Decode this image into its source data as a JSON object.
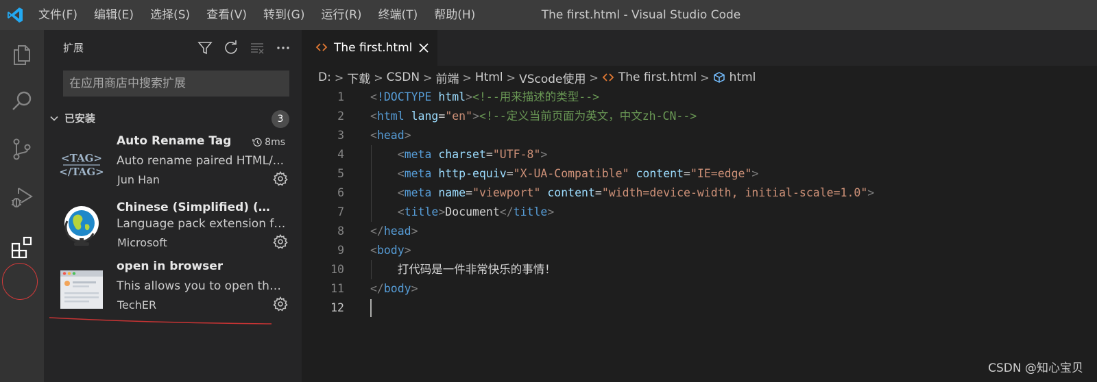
{
  "window": {
    "title": "The first.html - Visual Studio Code",
    "menu": [
      "文件(F)",
      "编辑(E)",
      "选择(S)",
      "查看(V)",
      "转到(G)",
      "运行(R)",
      "终端(T)",
      "帮助(H)"
    ]
  },
  "activity_bar": {
    "items": [
      "explorer-icon",
      "search-icon",
      "source-control-icon",
      "run-debug-icon",
      "extensions-icon"
    ],
    "active": "extensions-icon"
  },
  "sidebar": {
    "title": "扩展",
    "actions": [
      "filter-icon",
      "refresh-icon",
      "clear-icon",
      "more-icon"
    ],
    "search_placeholder": "在应用商店中搜索扩展",
    "installed_section": {
      "title": "已安装",
      "count": "3",
      "extensions": [
        {
          "name": "Auto Rename Tag",
          "time": "8ms",
          "description": "Auto rename paired HTML/...",
          "publisher": "Jun Han",
          "icon_text_top": "<TAG>",
          "icon_text_bottom": "</TAG>"
        },
        {
          "name": "Chinese (Simplified) (简...",
          "time": "",
          "description": "Language pack extension fo...",
          "publisher": "Microsoft"
        },
        {
          "name": "open in browser",
          "time": "",
          "description": "This allows you to open the ...",
          "publisher": "TechER"
        }
      ]
    }
  },
  "editor": {
    "tab": {
      "label": "The first.html"
    },
    "breadcrumb": [
      "D:",
      "下载",
      "CSDN",
      "前端",
      "Html",
      "VScode使用",
      "The first.html",
      "html"
    ],
    "active_line": "12",
    "lines": [
      {
        "n": "1",
        "tokens": [
          [
            "punct",
            "<"
          ],
          [
            "tag",
            "!DOCTYPE"
          ],
          [
            "text",
            " "
          ],
          [
            "attr",
            "html"
          ],
          [
            "punct",
            ">"
          ],
          [
            "com",
            "<!--用来描述的类型-->"
          ]
        ]
      },
      {
        "n": "2",
        "tokens": [
          [
            "punct",
            "<"
          ],
          [
            "tag",
            "html"
          ],
          [
            "text",
            " "
          ],
          [
            "attr",
            "lang"
          ],
          [
            "eq",
            "="
          ],
          [
            "str",
            "\"en\""
          ],
          [
            "punct",
            ">"
          ],
          [
            "com",
            "<!--定义当前页面为英文，中文zh-CN-->"
          ]
        ]
      },
      {
        "n": "3",
        "tokens": [
          [
            "punct",
            "<"
          ],
          [
            "tag",
            "head"
          ],
          [
            "punct",
            ">"
          ]
        ]
      },
      {
        "n": "4",
        "tokens": [
          [
            "text",
            "    "
          ],
          [
            "punct",
            "<"
          ],
          [
            "tag",
            "meta"
          ],
          [
            "text",
            " "
          ],
          [
            "attr",
            "charset"
          ],
          [
            "eq",
            "="
          ],
          [
            "str",
            "\"UTF-8\""
          ],
          [
            "punct",
            ">"
          ]
        ]
      },
      {
        "n": "5",
        "tokens": [
          [
            "text",
            "    "
          ],
          [
            "punct",
            "<"
          ],
          [
            "tag",
            "meta"
          ],
          [
            "text",
            " "
          ],
          [
            "attr",
            "http-equiv"
          ],
          [
            "eq",
            "="
          ],
          [
            "str",
            "\"X-UA-Compatible\""
          ],
          [
            "text",
            " "
          ],
          [
            "attr",
            "content"
          ],
          [
            "eq",
            "="
          ],
          [
            "str",
            "\"IE=edge\""
          ],
          [
            "punct",
            ">"
          ]
        ]
      },
      {
        "n": "6",
        "tokens": [
          [
            "text",
            "    "
          ],
          [
            "punct",
            "<"
          ],
          [
            "tag",
            "meta"
          ],
          [
            "text",
            " "
          ],
          [
            "attr",
            "name"
          ],
          [
            "eq",
            "="
          ],
          [
            "str",
            "\"viewport\""
          ],
          [
            "text",
            " "
          ],
          [
            "attr",
            "content"
          ],
          [
            "eq",
            "="
          ],
          [
            "str",
            "\"width=device-width, initial-scale=1.0\""
          ],
          [
            "punct",
            ">"
          ]
        ]
      },
      {
        "n": "7",
        "tokens": [
          [
            "text",
            "    "
          ],
          [
            "punct",
            "<"
          ],
          [
            "tag",
            "title"
          ],
          [
            "punct",
            ">"
          ],
          [
            "text",
            "Document"
          ],
          [
            "punct",
            "</"
          ],
          [
            "tag",
            "title"
          ],
          [
            "punct",
            ">"
          ]
        ]
      },
      {
        "n": "8",
        "tokens": [
          [
            "punct",
            "</"
          ],
          [
            "tag",
            "head"
          ],
          [
            "punct",
            ">"
          ]
        ]
      },
      {
        "n": "9",
        "tokens": [
          [
            "punct",
            "<"
          ],
          [
            "tag",
            "body"
          ],
          [
            "punct",
            ">"
          ]
        ]
      },
      {
        "n": "10",
        "tokens": [
          [
            "text",
            "    打代码是一件非常快乐的事情！"
          ]
        ]
      },
      {
        "n": "11",
        "tokens": [
          [
            "punct",
            "</"
          ],
          [
            "tag",
            "body"
          ],
          [
            "punct",
            ">"
          ]
        ]
      },
      {
        "n": "12",
        "tokens": []
      }
    ]
  },
  "watermark": "CSDN @知心宝贝"
}
